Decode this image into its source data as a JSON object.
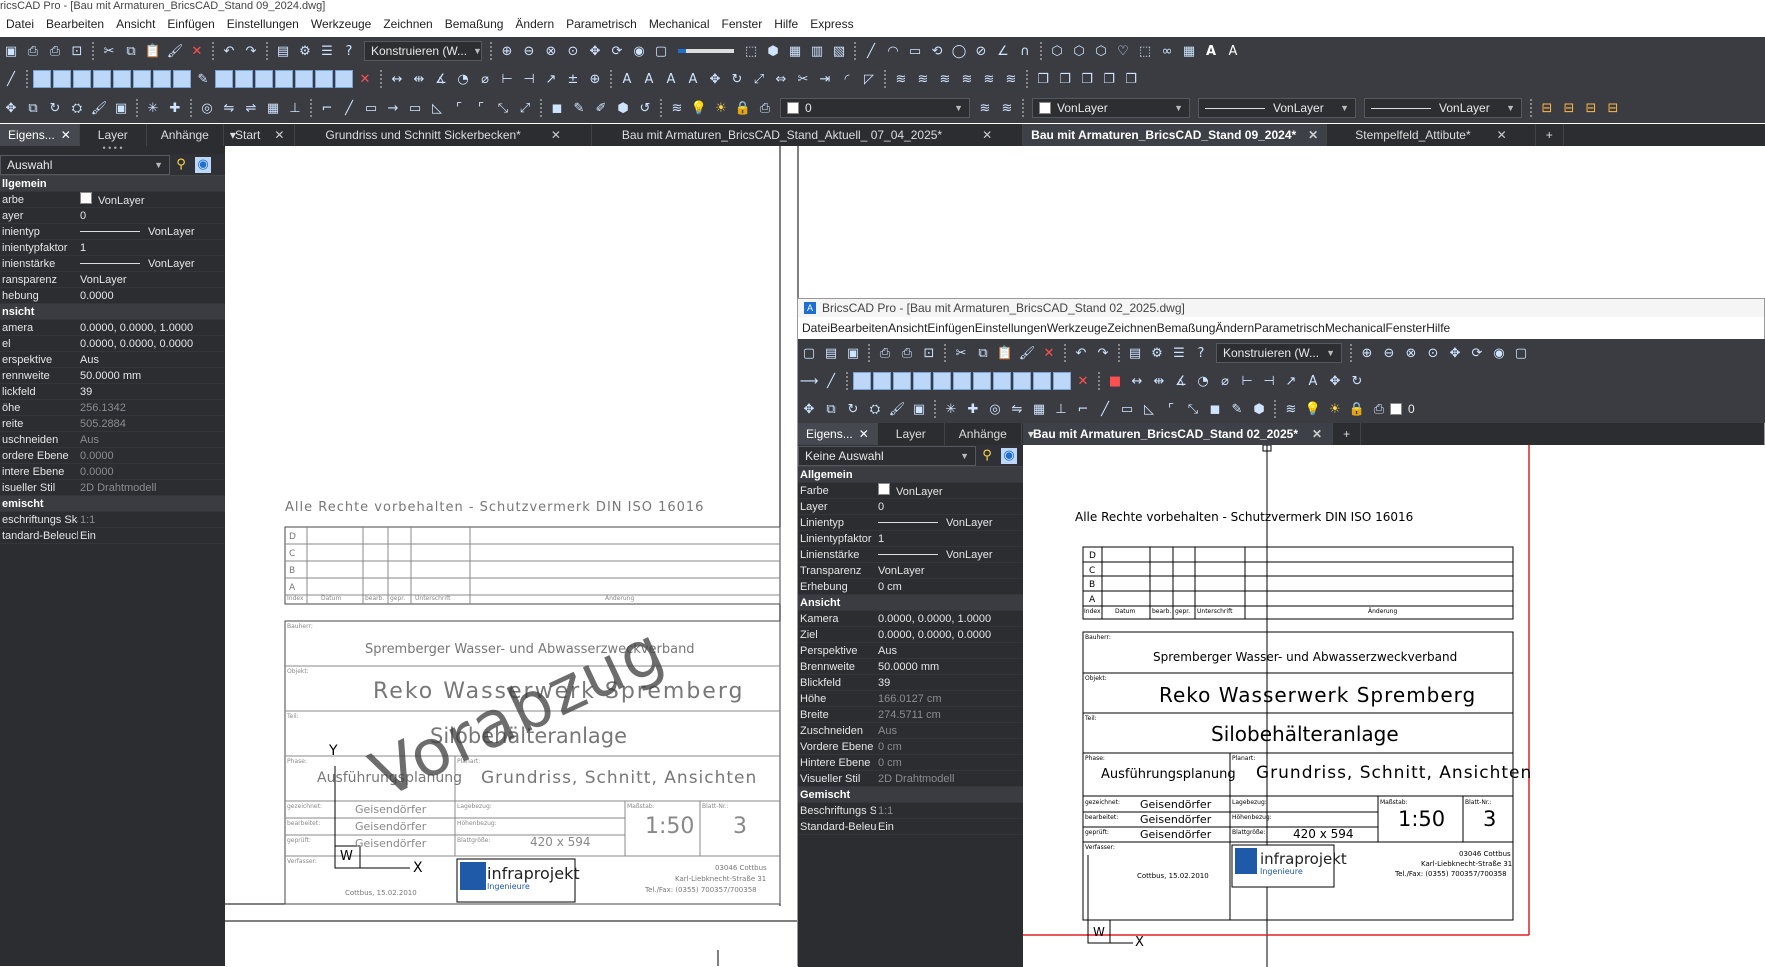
{
  "main_window": {
    "title": "ricsCAD Pro - [Bau mit Armaturen_BricsCAD_Stand 09_2024.dwg]",
    "menu": [
      "Datei",
      "Bearbeiten",
      "Ansicht",
      "Einfügen",
      "Einstellungen",
      "Werkzeuge",
      "Zeichnen",
      "Bemaßung",
      "Ändern",
      "Parametrisch",
      "Mechanical",
      "Fenster",
      "Hilfe",
      "Express"
    ],
    "workspace": "Konstruieren (W...",
    "layer_value": "0",
    "color_value": "VonLayer",
    "linetype_value": "VonLayer",
    "lineweight_value": "VonLayer",
    "panel_tabs": [
      "Eigens...",
      "Layer",
      "Anhänge"
    ],
    "doc_tabs": [
      "Start",
      "Grundriss und Schnitt Sickerbecken*",
      "Bau mit Armaturen_BricsCAD_Stand_Aktuell_ 07_04_2025*",
      "Bau mit Armaturen_BricsCAD_Stand 09_2024*",
      "Stempelfeld_Attibute*"
    ],
    "selection": "Auswahl",
    "properties": [
      {
        "k": "llgemein",
        "v": "",
        "section": true
      },
      {
        "k": "arbe",
        "v": "VonLayer",
        "swatch": true
      },
      {
        "k": "ayer",
        "v": "0"
      },
      {
        "k": "inientyp",
        "v": "VonLayer",
        "line": true
      },
      {
        "k": "inientypfaktor",
        "v": "1"
      },
      {
        "k": "inienstärke",
        "v": "VonLayer",
        "line": true
      },
      {
        "k": "ransparenz",
        "v": "VonLayer"
      },
      {
        "k": "hebung",
        "v": "0.0000"
      },
      {
        "k": "nsicht",
        "v": "",
        "section": true
      },
      {
        "k": "amera",
        "v": "0.0000, 0.0000, 1.0000"
      },
      {
        "k": "el",
        "v": "0.0000, 0.0000, 0.0000"
      },
      {
        "k": "erspektive",
        "v": "Aus"
      },
      {
        "k": "rennweite",
        "v": "50.0000 mm"
      },
      {
        "k": "lickfeld",
        "v": "39"
      },
      {
        "k": "öhe",
        "v": "256.1342",
        "dim": true
      },
      {
        "k": "reite",
        "v": "505.2884",
        "dim": true
      },
      {
        "k": "uschneiden",
        "v": "Aus",
        "dim": true
      },
      {
        "k": "ordere Ebene",
        "v": "0.0000",
        "dim": true
      },
      {
        "k": "intere Ebene",
        "v": "0.0000",
        "dim": true
      },
      {
        "k": "isueller Stil",
        "v": "2D Drahtmodell",
        "dim": true
      },
      {
        "k": "emischt",
        "v": "",
        "section": true
      },
      {
        "k": "eschriftungs Skal",
        "v": "1:1",
        "dim": true
      },
      {
        "k": "tandard-Beleucht",
        "v": "Ein"
      }
    ]
  },
  "second_window": {
    "title": "BricsCAD Pro - [Bau mit Armaturen_BricsCAD_Stand 02_2025.dwg]",
    "menu": [
      "Datei",
      "Bearbeiten",
      "Ansicht",
      "Einfügen",
      "Einstellungen",
      "Werkzeuge",
      "Zeichnen",
      "Bemaßung",
      "Ändern",
      "Parametrisch",
      "Mechanical",
      "Fenster",
      "Hilfe"
    ],
    "workspace": "Konstruieren (W...",
    "layer_value": "0",
    "panel_tabs": [
      "Eigens...",
      "Layer",
      "Anhänge"
    ],
    "doc_tab": "Bau mit Armaturen_BricsCAD_Stand 02_2025*",
    "selection": "Keine Auswahl",
    "properties": [
      {
        "k": "Allgemein",
        "v": "",
        "section": true
      },
      {
        "k": "Farbe",
        "v": "VonLayer",
        "swatch": true
      },
      {
        "k": "Layer",
        "v": "0"
      },
      {
        "k": "Linientyp",
        "v": "VonLayer",
        "line": true
      },
      {
        "k": "Linientypfaktor",
        "v": "1"
      },
      {
        "k": "Linienstärke",
        "v": "VonLayer",
        "line": true
      },
      {
        "k": "Transparenz",
        "v": "VonLayer"
      },
      {
        "k": "Erhebung",
        "v": "0 cm"
      },
      {
        "k": "Ansicht",
        "v": "",
        "section": true
      },
      {
        "k": "Kamera",
        "v": "0.0000, 0.0000, 1.0000"
      },
      {
        "k": "Ziel",
        "v": "0.0000, 0.0000, 0.0000"
      },
      {
        "k": "Perspektive",
        "v": "Aus"
      },
      {
        "k": "Brennweite",
        "v": "50.0000 mm"
      },
      {
        "k": "Blickfeld",
        "v": "39"
      },
      {
        "k": "Höhe",
        "v": "166.0127 cm",
        "dim": true
      },
      {
        "k": "Breite",
        "v": "274.5711 cm",
        "dim": true
      },
      {
        "k": "Zuschneiden",
        "v": "Aus",
        "dim": true
      },
      {
        "k": "Vordere Ebene",
        "v": "0 cm",
        "dim": true
      },
      {
        "k": "Hintere Ebene",
        "v": "0 cm",
        "dim": true
      },
      {
        "k": "Visueller Stil",
        "v": "2D Drahtmodell",
        "dim": true
      },
      {
        "k": "Gemischt",
        "v": "",
        "section": true
      },
      {
        "k": "Beschriftungs Skal",
        "v": "1:1",
        "dim": true
      },
      {
        "k": "Standard-Beleucht",
        "v": "Ein"
      }
    ]
  },
  "drawing": {
    "copyright": "Alle Rechte vorbehalten - Schutzvermerk DIN ISO 16016",
    "revision_letters": [
      "D",
      "C",
      "B",
      "A"
    ],
    "revision_header": [
      "Index",
      "Datum",
      "bearb.",
      "gepr.",
      "Unterschrift",
      "Änderung"
    ],
    "bauherr_label": "Bauherr:",
    "bauherr": "Spremberger Wasser- und Abwasserzweckverband",
    "objekt_label": "Objekt:",
    "objekt": "Reko Wasserwerk Spremberg",
    "teil_label": "Teil:",
    "teil": "Silobehälteranlage",
    "phase_label": "Phase:",
    "phase": "Ausführungsplanung",
    "planart_label": "Planart:",
    "planart": "Grundriss, Schnitt, Ansichten",
    "gezeichnet_label": "gezeichnet:",
    "bearbeitet_label": "bearbeitet:",
    "geprueft_label": "geprüft:",
    "person": "Geisendörfer",
    "lagebezug_label": "Lagebezug:",
    "hoehenbezug_label": "Höhenbezug:",
    "blattgroesse_label": "Blattgröße:",
    "blattgroesse": "420 x 594",
    "massstab_label": "Maßstab:",
    "massstab": "1:50",
    "blatt_label": "Blatt-Nr.:",
    "blatt": "3",
    "verfasser_label": "Verfasser:",
    "ort_datum": "Cottbus, 15.02.2010",
    "adresse1": "03046 Cottbus",
    "adresse2": "Karl-Liebknecht-Straße 31",
    "adresse3": "Tel./Fax: (0355) 700357/700358",
    "logo_main": "infraprojekt",
    "logo_sub": "Ingenieure",
    "watermark": "Vorabzug",
    "axis_y": "Y",
    "axis_x": "X",
    "axis_w": "W"
  },
  "colors": {
    "toolbar_bg": "#3a3c41",
    "panel_bg": "#2b2d31",
    "accent": "#1f6fd1",
    "red_frame": "#e02020"
  }
}
